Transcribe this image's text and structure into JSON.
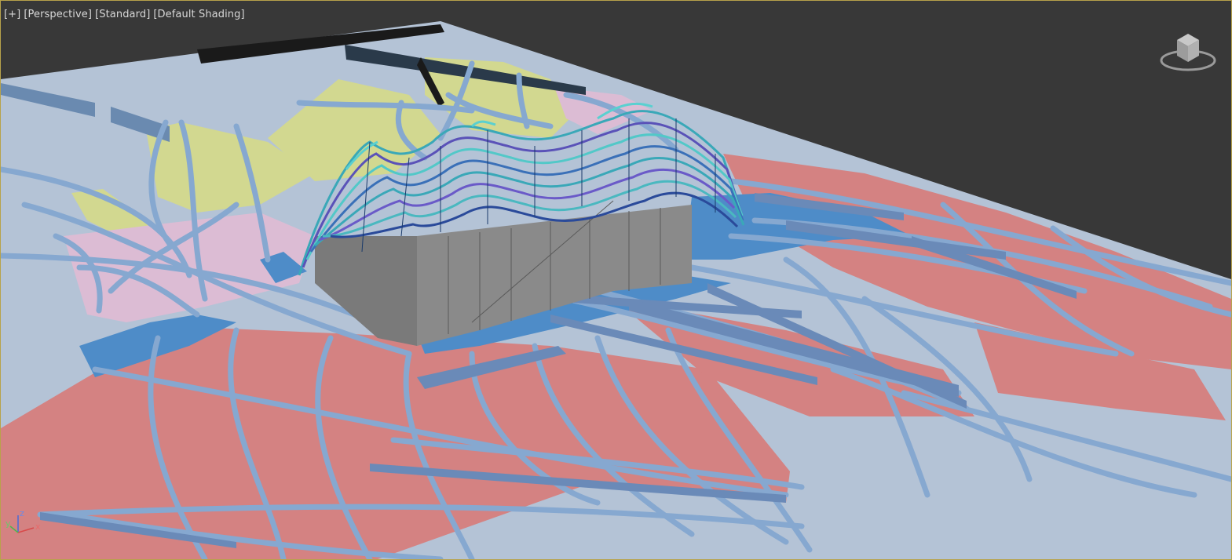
{
  "viewport": {
    "labels": [
      "[+]",
      "[Perspective]",
      "[Standard]",
      "[Default Shading]"
    ],
    "axes": {
      "x": "x",
      "y": "y",
      "z": "z"
    },
    "viewcube_icon": "viewcube-icon"
  },
  "colors": {
    "background": "#383838",
    "ground": "#b4c3d6",
    "strip": "#86a8d0",
    "strip_dark": "#4a78a4",
    "red_zone": "#d48282",
    "pink_zone": "#dcbcd4",
    "yellow_zone": "#d2d890",
    "blue_zone": "#4e8cc8",
    "building": "#8a8a8a",
    "roof_teal": "#3aa8b8",
    "roof_purple": "#5a52b8",
    "border": "#b8a24a"
  }
}
